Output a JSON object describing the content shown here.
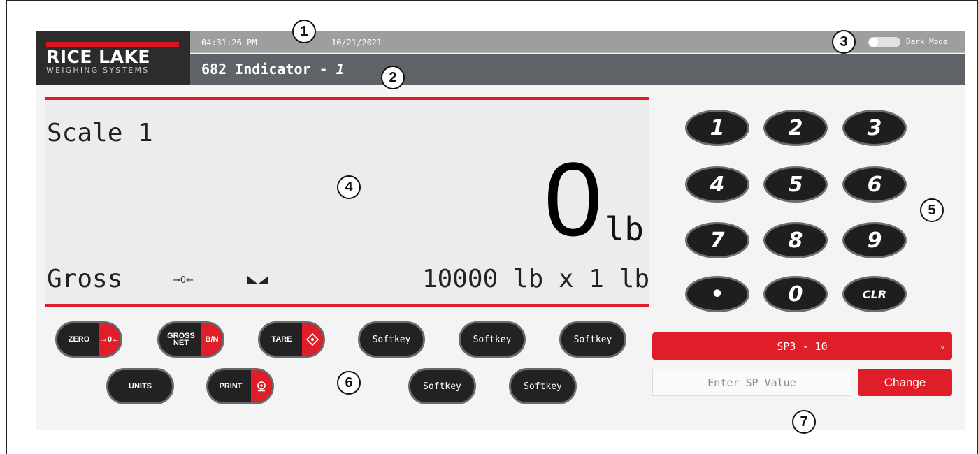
{
  "header": {
    "brand": "RICE LAKE",
    "brand_sub": "WEIGHING SYSTEMS",
    "time": "04:31:26 PM",
    "date": "10/21/2021",
    "dark_mode_label": "Dark Mode",
    "title": "682 Indicator - ",
    "title_number": "1"
  },
  "display": {
    "scale_name": "Scale 1",
    "weight": "0",
    "unit": "lb",
    "mode": "Gross",
    "zero_annunciator": "→0←",
    "capacity": "10000 lb x 1 lb"
  },
  "buttons": {
    "zero": "ZERO",
    "zero_icon": "→0←",
    "gross_net_1": "GROSS",
    "gross_net_2": "NET",
    "gross_net_icon": "B/N",
    "tare": "TARE",
    "units": "UNITS",
    "print": "PRINT",
    "softkeys": [
      "Softkey",
      "Softkey",
      "Softkey",
      "Softkey",
      "Softkey"
    ]
  },
  "keypad": [
    "1",
    "2",
    "3",
    "4",
    "5",
    "6",
    "7",
    "8",
    "9",
    "•",
    "0",
    "CLR"
  ],
  "setpoint": {
    "selected": "SP3 - 10",
    "placeholder": "Enter SP Value",
    "change_label": "Change"
  },
  "callouts": [
    "1",
    "2",
    "3",
    "4",
    "5",
    "6",
    "7"
  ],
  "colors": {
    "accent_red": "#e01e2a",
    "title_bar": "#5f6367",
    "status_bar": "#9e9e9e",
    "logo_bg": "#2c2c2c"
  }
}
